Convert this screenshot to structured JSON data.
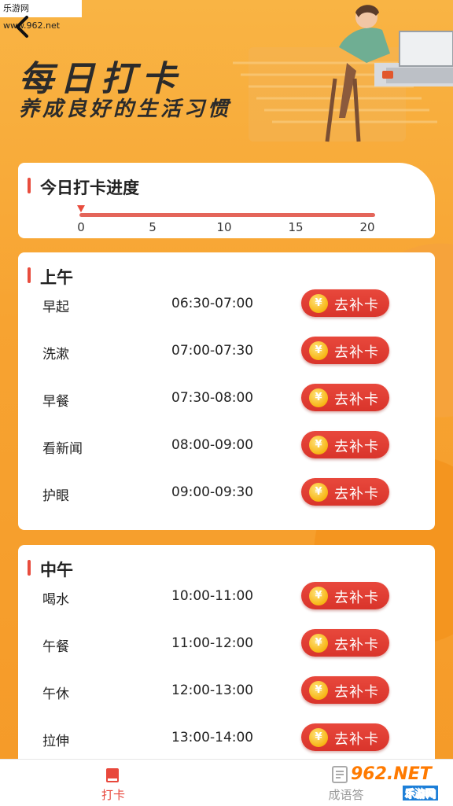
{
  "watermark_top": "乐游网 www.962.net",
  "header": {
    "title": "每日打卡",
    "subtitle": "养成良好的生活习惯"
  },
  "progress": {
    "title": "今日打卡进度",
    "ticks": [
      "0",
      "5",
      "10",
      "15",
      "20"
    ],
    "current": 0,
    "max": 20
  },
  "sections": [
    {
      "title": "上午",
      "items": [
        {
          "name": "早起",
          "time": "06:30-07:00",
          "button": "去补卡"
        },
        {
          "name": "洗漱",
          "time": "07:00-07:30",
          "button": "去补卡"
        },
        {
          "name": "早餐",
          "time": "07:30-08:00",
          "button": "去补卡"
        },
        {
          "name": "看新闻",
          "time": "08:00-09:00",
          "button": "去补卡"
        },
        {
          "name": "护眼",
          "time": "09:00-09:30",
          "button": "去补卡"
        }
      ]
    },
    {
      "title": "中午",
      "items": [
        {
          "name": "喝水",
          "time": "10:00-11:00",
          "button": "去补卡"
        },
        {
          "name": "午餐",
          "time": "11:00-12:00",
          "button": "去补卡"
        },
        {
          "name": "午休",
          "time": "12:00-13:00",
          "button": "去补卡"
        },
        {
          "name": "拉伸",
          "time": "13:00-14:00",
          "button": "去补卡"
        }
      ]
    }
  ],
  "coin_symbol": "¥",
  "tabbar": {
    "tabs": [
      {
        "label": "打卡",
        "icon": "book-icon",
        "active": true
      },
      {
        "label": "成语答",
        "icon": "document-icon",
        "active": false
      }
    ]
  },
  "watermark_bottom": {
    "main": "962.NET",
    "sub": "乐游网"
  },
  "colors": {
    "accent": "#e8483c",
    "background": "#f7a531",
    "coin": "#f7b514"
  }
}
